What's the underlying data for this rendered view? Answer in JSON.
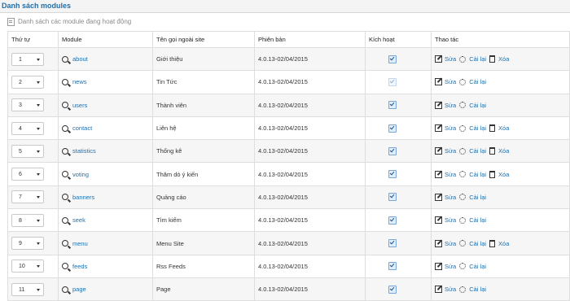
{
  "page_title": "Danh sách modules",
  "panel_title": "Danh sách các module đang hoạt động",
  "headers": {
    "order": "Thứ tự",
    "module": "Module",
    "title": "Tên gọi ngoài site",
    "version": "Phiên bản",
    "active": "Kích hoạt",
    "actions": "Thao tác"
  },
  "action_labels": {
    "edit": "Sửa",
    "reinstall": "Cài lại",
    "delete": "Xóa"
  },
  "rows": [
    {
      "order": "1",
      "module": "about",
      "title": "Giới thiệu",
      "version": "4.0.13-02/04/2015",
      "active": true,
      "active_disabled": false,
      "deletable": true
    },
    {
      "order": "2",
      "module": "news",
      "title": "Tin Tức",
      "version": "4.0.13-02/04/2015",
      "active": true,
      "active_disabled": true,
      "deletable": false
    },
    {
      "order": "3",
      "module": "users",
      "title": "Thành viên",
      "version": "4.0.13-02/04/2015",
      "active": true,
      "active_disabled": false,
      "deletable": false
    },
    {
      "order": "4",
      "module": "contact",
      "title": "Liên hệ",
      "version": "4.0.13-02/04/2015",
      "active": true,
      "active_disabled": false,
      "deletable": true
    },
    {
      "order": "5",
      "module": "statistics",
      "title": "Thống kê",
      "version": "4.0.13-02/04/2015",
      "active": true,
      "active_disabled": false,
      "deletable": true
    },
    {
      "order": "6",
      "module": "voting",
      "title": "Thăm dò ý kiến",
      "version": "4.0.13-02/04/2015",
      "active": true,
      "active_disabled": false,
      "deletable": true
    },
    {
      "order": "7",
      "module": "banners",
      "title": "Quảng cáo",
      "version": "4.0.13-02/04/2015",
      "active": true,
      "active_disabled": false,
      "deletable": false
    },
    {
      "order": "8",
      "module": "seek",
      "title": "Tìm kiếm",
      "version": "4.0.13-02/04/2015",
      "active": true,
      "active_disabled": false,
      "deletable": false
    },
    {
      "order": "9",
      "module": "menu",
      "title": "Menu Site",
      "version": "4.0.13-02/04/2015",
      "active": true,
      "active_disabled": false,
      "deletable": true
    },
    {
      "order": "10",
      "module": "feeds",
      "title": "Rss Feeds",
      "version": "4.0.13-02/04/2015",
      "active": true,
      "active_disabled": false,
      "deletable": false
    },
    {
      "order": "11",
      "module": "page",
      "title": "Page",
      "version": "4.0.13-02/04/2015",
      "active": true,
      "active_disabled": false,
      "deletable": false
    }
  ],
  "icons": {
    "search": "search-icon",
    "edit": "edit-icon",
    "reinstall": "gear-icon",
    "delete": "trash-icon",
    "panel": "document-icon"
  },
  "colors": {
    "link": "#1f6fad",
    "title": "#1f6fad",
    "row_alt": "#f6f6f6"
  }
}
